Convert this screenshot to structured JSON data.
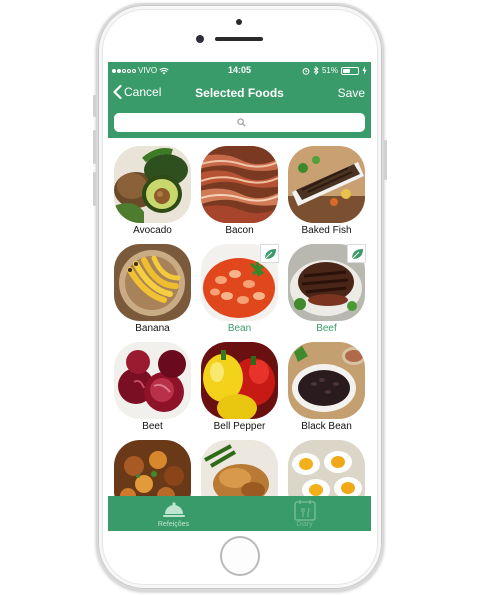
{
  "status": {
    "carrier": "VIVO",
    "time": "14:05",
    "battery_percent": "51%",
    "battery_level": 0.51,
    "signal_bars_filled": 2,
    "signal_bars_total": 5
  },
  "nav": {
    "back_label": "Cancel",
    "title": "Selected Foods",
    "save_label": "Save"
  },
  "search": {
    "placeholder": "",
    "value": ""
  },
  "foods": [
    {
      "name": "Avocado",
      "selected": false
    },
    {
      "name": "Bacon",
      "selected": false
    },
    {
      "name": "Baked Fish",
      "selected": false
    },
    {
      "name": "Banana",
      "selected": false
    },
    {
      "name": "Bean",
      "selected": true
    },
    {
      "name": "Beef",
      "selected": true
    },
    {
      "name": "Beet",
      "selected": false
    },
    {
      "name": "Bell Pepper",
      "selected": false
    },
    {
      "name": "Black Bean",
      "selected": false
    },
    {
      "name": "",
      "selected": false
    },
    {
      "name": "",
      "selected": false
    },
    {
      "name": "",
      "selected": false
    }
  ],
  "tabs": [
    {
      "label": "Refeições",
      "icon": "cloche-icon",
      "active": true
    },
    {
      "label": "Diary",
      "icon": "diary-icon",
      "active": false
    }
  ],
  "colors": {
    "brand_green": "#3a9b6a",
    "selected_text": "#3a9b6a"
  }
}
